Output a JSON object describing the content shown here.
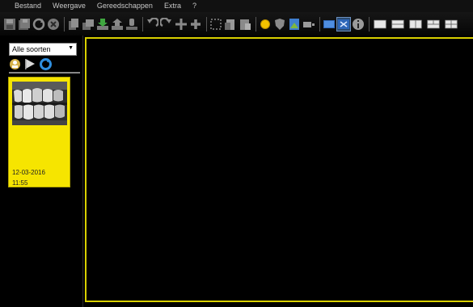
{
  "menubar": {
    "items": [
      "Bestand",
      "Weergave",
      "Gereedschappen",
      "Extra",
      "?"
    ]
  },
  "toolbar": {
    "icons": [
      "save-icon",
      "save-all-icon",
      "refresh-icon",
      "delete-icon",
      "copy-images-icon",
      "paste-images-icon",
      "import-icon",
      "export-icon",
      "acquire-icon",
      "rotate-left-icon",
      "rotate-right-icon",
      "flip-icon",
      "add-icon",
      "select-region-icon",
      "copy-icon",
      "paste-icon",
      "sun-icon",
      "shield-icon",
      "image-enhance-icon",
      "brightness-icon",
      "monitor-icon",
      "fullscreen-icon",
      "info-icon",
      "layout-single-icon",
      "layout-two-horizontal-icon",
      "layout-two-vertical-icon",
      "layout-three-icon",
      "layout-four-icon"
    ]
  },
  "sidebar": {
    "filter_select": {
      "value": "Alle soorten"
    },
    "filter_icons": [
      "user-filter-icon",
      "flag-filter-icon",
      "sync-icon"
    ],
    "thumbnails": [
      {
        "date": "12-03-2016",
        "time": "11:55",
        "image": "dental-xray-thumbnail"
      }
    ]
  },
  "colors": {
    "background": "#000000",
    "selection_yellow": "#f6e500",
    "viewer_border": "#d9d000"
  }
}
